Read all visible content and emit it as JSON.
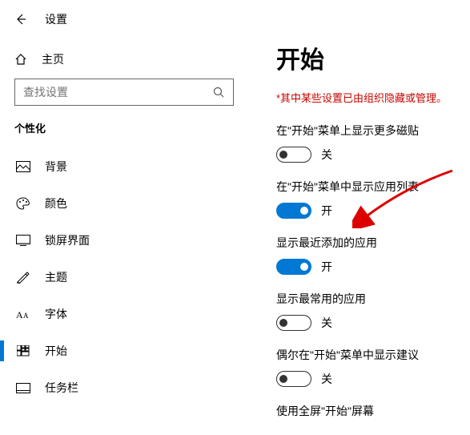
{
  "header": {
    "title": "设置"
  },
  "sidebar": {
    "home_label": "主页",
    "search_placeholder": "查找设置",
    "section_title": "个性化",
    "items": [
      {
        "label": "背景"
      },
      {
        "label": "颜色"
      },
      {
        "label": "锁屏界面"
      },
      {
        "label": "主题"
      },
      {
        "label": "字体"
      },
      {
        "label": "开始"
      },
      {
        "label": "任务栏"
      }
    ]
  },
  "main": {
    "title": "开始",
    "notice": "*其中某些设置已由组织隐藏或管理。",
    "settings": [
      {
        "label": "在\"开始\"菜单上显示更多磁贴",
        "state_label": "关"
      },
      {
        "label": "在\"开始\"菜单中显示应用列表",
        "state_label": "开"
      },
      {
        "label": "显示最近添加的应用",
        "state_label": "开"
      },
      {
        "label": "显示最常用的应用",
        "state_label": "关"
      },
      {
        "label": "偶尔在\"开始\"菜单中显示建议",
        "state_label": "关"
      },
      {
        "label": "使用全屏\"开始\"屏幕",
        "state_label": ""
      }
    ]
  }
}
